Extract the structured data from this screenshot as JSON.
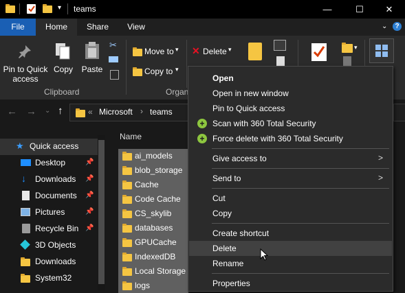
{
  "window": {
    "title": "teams"
  },
  "ribbon_tabs": [
    "File",
    "Home",
    "Share",
    "View"
  ],
  "ribbon": {
    "pin_label_1": "Pin to Quick",
    "pin_label_2": "access",
    "copy": "Copy",
    "paste": "Paste",
    "move_to": "Move to",
    "copy_to": "Copy to",
    "delete": "Delete",
    "clipboard_group": "Clipboard",
    "organize_group": "Organ"
  },
  "address": {
    "crumbs": [
      "Microsoft",
      "teams"
    ],
    "overflow": "«"
  },
  "list": {
    "header": "Name",
    "items": [
      "ai_models",
      "blob_storage",
      "Cache",
      "Code Cache",
      "CS_skylib",
      "databases",
      "GPUCache",
      "IndexedDB",
      "Local Storage",
      "logs"
    ]
  },
  "nav": {
    "quick_access": "Quick access",
    "items": [
      {
        "label": "Desktop",
        "pinned": true
      },
      {
        "label": "Downloads",
        "pinned": true
      },
      {
        "label": "Documents",
        "pinned": true
      },
      {
        "label": "Pictures",
        "pinned": true
      },
      {
        "label": "Recycle Bin",
        "pinned": true
      },
      {
        "label": "3D Objects",
        "pinned": false
      },
      {
        "label": "Downloads",
        "pinned": false
      },
      {
        "label": "System32",
        "pinned": false
      }
    ]
  },
  "context_menu": {
    "open": "Open",
    "open_new_window": "Open in new window",
    "pin_quick": "Pin to Quick access",
    "scan_360": "Scan with 360 Total Security",
    "force_delete_360": "Force delete with 360 Total Security",
    "give_access": "Give access to",
    "send_to": "Send to",
    "cut": "Cut",
    "copy": "Copy",
    "create_shortcut": "Create shortcut",
    "delete": "Delete",
    "rename": "Rename",
    "properties": "Properties"
  },
  "colors": {
    "file_tab": "#1a5fb4",
    "folder": "#f5c542",
    "selection": "#606060",
    "menu_bg": "#2b2b2b",
    "menu_hover": "#414141",
    "security_icon": "#8dc63f"
  }
}
